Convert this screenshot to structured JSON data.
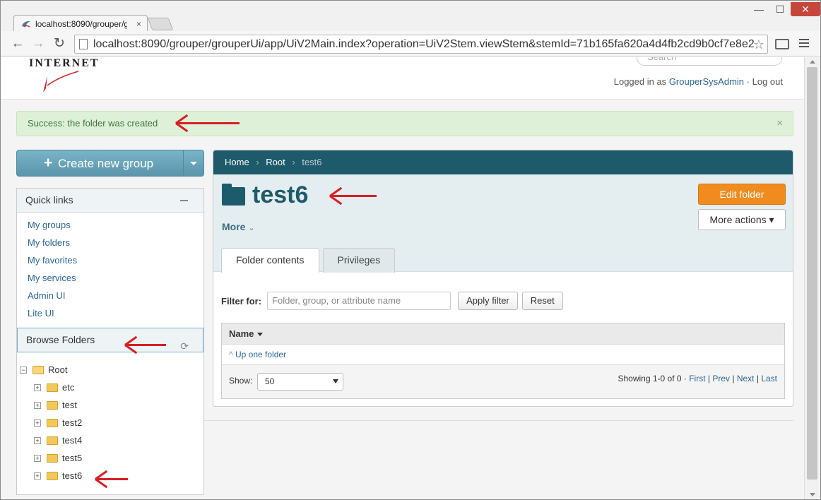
{
  "browser": {
    "tab_title": "localhost:8090/grouper/gr",
    "tab_close": "×",
    "url": "localhost:8090/grouper/grouperUi/app/UiV2Main.index?operation=UiV2Stem.viewStem&stemId=71b165fa620a4d4fb2cd9b0cf7e8e2",
    "window_min": "—",
    "window_max": "☐",
    "window_close": "✕"
  },
  "header": {
    "logo_text": "INTERNET",
    "search_placeholder": "Search",
    "logged_in_prefix": "Logged in as",
    "user_name": "GrouperSysAdmin",
    "separator": "·",
    "logout": "Log out"
  },
  "alert": {
    "message": "Success: the folder was created",
    "close": "×"
  },
  "create_group": {
    "plus": "+",
    "label": "Create new group"
  },
  "quick_links": {
    "title": "Quick links",
    "items": [
      "My groups",
      "My folders",
      "My favorites",
      "My services",
      "Admin UI",
      "Lite UI"
    ]
  },
  "browse_folders": {
    "title": "Browse Folders",
    "refresh_icon": "⟳",
    "root": {
      "label": "Root",
      "toggle": "−"
    },
    "children": [
      {
        "label": "etc",
        "toggle": "+"
      },
      {
        "label": "test",
        "toggle": "+"
      },
      {
        "label": "test2",
        "toggle": "+"
      },
      {
        "label": "test4",
        "toggle": "+"
      },
      {
        "label": "test5",
        "toggle": "+"
      },
      {
        "label": "test6",
        "toggle": "+"
      }
    ]
  },
  "breadcrumb": {
    "home": "Home",
    "root": "Root",
    "current": "test6",
    "sep": "›"
  },
  "folder": {
    "title": "test6",
    "more_label": "More",
    "more_caret": "⌄",
    "edit_button": "Edit folder",
    "more_actions_button": "More actions ▾"
  },
  "tabs": [
    {
      "label": "Folder contents",
      "active": true
    },
    {
      "label": "Privileges",
      "active": false
    }
  ],
  "filter": {
    "label": "Filter for:",
    "placeholder": "Folder, group, or attribute name",
    "apply": "Apply filter",
    "reset": "Reset"
  },
  "table": {
    "column_name": "Name",
    "up_folder": "Up one folder",
    "up_caret": "^",
    "show_label": "Show:",
    "show_value": "50",
    "showing": "Showing 1-0 of 0 · ",
    "first": "First",
    "prev": "Prev",
    "next": "Next",
    "last": "Last",
    "pipe": " | "
  },
  "colors": {
    "accent": "#1d5a6b",
    "edit_button": "#f08c1f",
    "alert_bg": "#dff0d8",
    "annotation": "#d81f24"
  }
}
